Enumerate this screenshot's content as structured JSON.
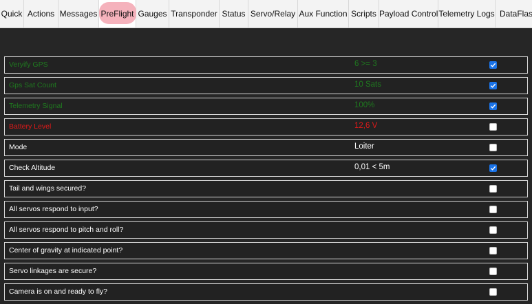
{
  "tabs": [
    {
      "label": "Quick"
    },
    {
      "label": "Actions"
    },
    {
      "label": "Messages"
    },
    {
      "label": "PreFlight"
    },
    {
      "label": "Gauges"
    },
    {
      "label": "Transponder"
    },
    {
      "label": "Status"
    },
    {
      "label": "Servo/Relay"
    },
    {
      "label": "Aux Function"
    },
    {
      "label": "Scripts"
    },
    {
      "label": "Payload Control"
    },
    {
      "label": "Telemetry Logs"
    },
    {
      "label": "DataFlash"
    }
  ],
  "active_tab": "PreFlight",
  "checklist": [
    {
      "label": "Veryify GPS",
      "value": "6 >= 3",
      "checked": true,
      "status": "green"
    },
    {
      "label": "Gps Sat Count",
      "value": "10 Sats",
      "checked": true,
      "status": "green"
    },
    {
      "label": "Telemetry Signal",
      "value": "100%",
      "checked": true,
      "status": "green"
    },
    {
      "label": "Battery Level",
      "value": "12,6 V",
      "checked": false,
      "status": "red"
    },
    {
      "label": "Mode",
      "value": "Loiter",
      "checked": false,
      "status": "normal"
    },
    {
      "label": "Check Altitude",
      "value": "0,01 < 5m",
      "checked": true,
      "status": "normal"
    },
    {
      "label": "Tail and wings secured?",
      "value": "",
      "checked": false,
      "status": "normal"
    },
    {
      "label": "All servos respond to input?",
      "value": "",
      "checked": false,
      "status": "normal"
    },
    {
      "label": "All servos respond to pitch and roll?",
      "value": "",
      "checked": false,
      "status": "normal"
    },
    {
      "label": "Center of gravity at indicated point?",
      "value": "",
      "checked": false,
      "status": "normal"
    },
    {
      "label": "Servo linkages are secure?",
      "value": "",
      "checked": false,
      "status": "normal"
    },
    {
      "label": "Camera is on and ready to fly?",
      "value": "",
      "checked": false,
      "status": "normal"
    }
  ],
  "colors": {
    "ok": "#1f7a1f",
    "warning": "#e01919",
    "checkbox_checked": "#1a73e8",
    "background": "#262626",
    "highlight": "#f4aab5"
  }
}
